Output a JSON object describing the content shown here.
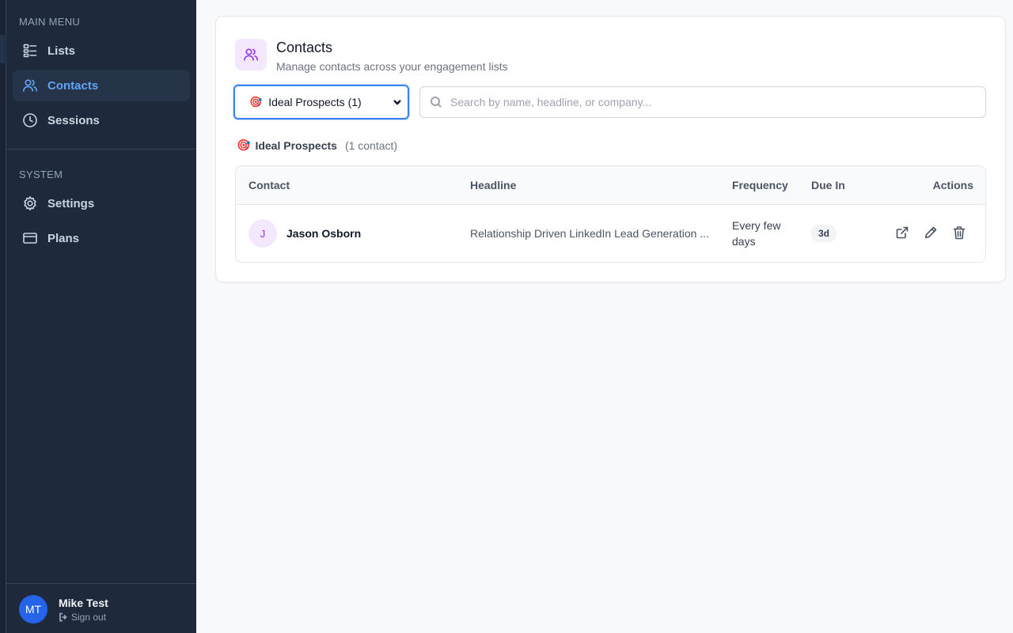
{
  "sidebar": {
    "main_menu_label": "MAIN MENU",
    "system_label": "SYSTEM",
    "items": [
      {
        "label": "Lists",
        "icon": "list-icon"
      },
      {
        "label": "Contacts",
        "icon": "users-icon",
        "active": true
      },
      {
        "label": "Sessions",
        "icon": "clock-icon"
      },
      {
        "label": "Settings",
        "icon": "gear-icon"
      },
      {
        "label": "Plans",
        "icon": "credit-card-icon"
      }
    ],
    "user": {
      "initials": "MT",
      "name": "Mike Test",
      "signout": "Sign out"
    }
  },
  "page": {
    "title": "Contacts",
    "subtitle": "Manage contacts across your engagement lists",
    "icon": "users-icon"
  },
  "filter": {
    "selected": "Ideal Prospects (1)",
    "emoji": "🎯"
  },
  "search": {
    "placeholder": "Search by name, headline, or company..."
  },
  "list": {
    "emoji": "🎯",
    "name": "Ideal Prospects",
    "count": "(1 contact)"
  },
  "table": {
    "headers": {
      "contact": "Contact",
      "headline": "Headline",
      "frequency": "Frequency",
      "due": "Due In",
      "actions": "Actions"
    },
    "rows": [
      {
        "initial": "J",
        "name": "Jason Osborn",
        "headline": "Relationship Driven LinkedIn Lead Generation ...",
        "frequency_line1": "Every few",
        "frequency_line2": "days",
        "due": "3d"
      }
    ]
  },
  "colors": {
    "sidebar_bg": "#1e293b",
    "accent": "#3b82f6",
    "active_text": "#60a5fa",
    "purple": "#9333ea"
  }
}
